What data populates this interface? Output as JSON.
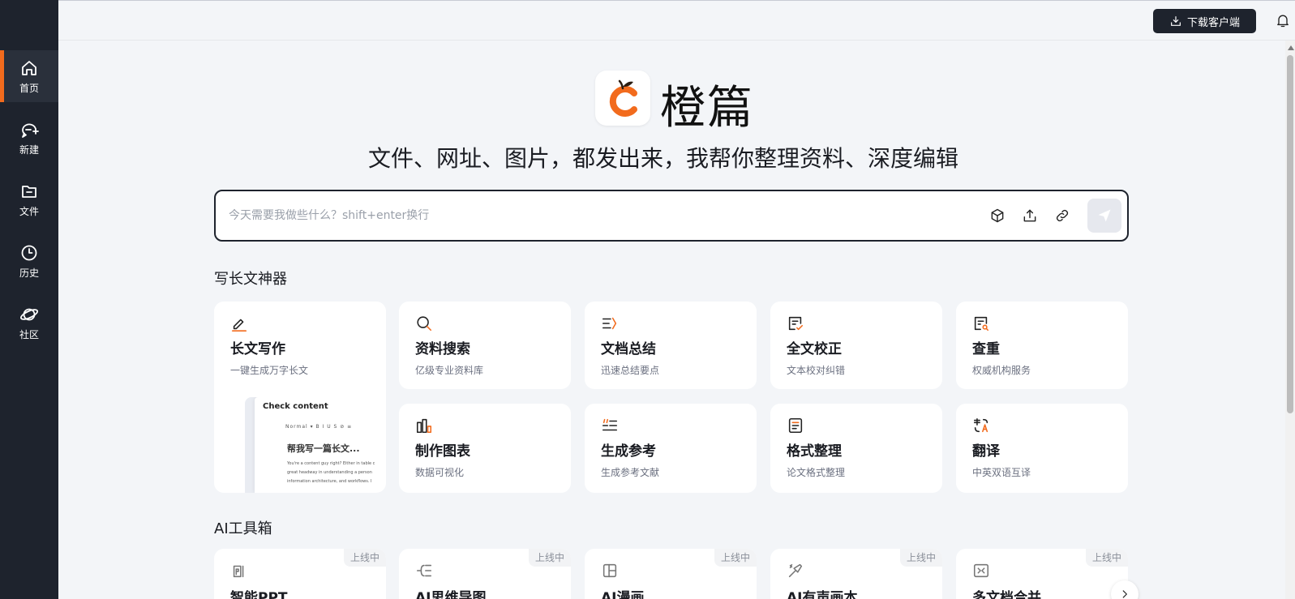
{
  "sidebar": {
    "items": [
      {
        "label": "首页",
        "icon": "home-icon",
        "active": true
      },
      {
        "label": "新建",
        "icon": "new-chat-icon",
        "active": false
      },
      {
        "label": "文件",
        "icon": "folder-icon",
        "active": false
      },
      {
        "label": "历史",
        "icon": "clock-icon",
        "active": false
      },
      {
        "label": "社区",
        "icon": "planet-icon",
        "active": false
      }
    ]
  },
  "header": {
    "download_label": "下载客户端"
  },
  "hero": {
    "brand": "橙篇",
    "tagline": "文件、网址、图片，都发出来，我帮你整理资料、深度编辑"
  },
  "search": {
    "placeholder": "今天需要我做些什么？shift+enter换行"
  },
  "writing_section": {
    "title": "写长文神器",
    "featured": {
      "title": "长文写作",
      "desc": "一键生成万字长文",
      "icon": "pen-icon",
      "preview": {
        "title": "Check content",
        "toolbar": "Normal ▾   B  I  U  S  ⊘   ≡",
        "heading": "帮我写一篇长文...",
        "lines": [
          "You're a content guy right? Either in table c",
          "great headway in understanding a person",
          "information architecture, and workflows. I"
        ]
      }
    },
    "cards": [
      {
        "title": "资料搜索",
        "desc": "亿级专业资料库",
        "icon": "search-icon"
      },
      {
        "title": "文档总结",
        "desc": "迅速总结要点",
        "icon": "summary-icon"
      },
      {
        "title": "全文校正",
        "desc": "文本校对纠错",
        "icon": "proofread-icon"
      },
      {
        "title": "查重",
        "desc": "权威机构服务",
        "icon": "plagiarism-check-icon"
      },
      {
        "title": "制作图表",
        "desc": "数据可视化",
        "icon": "chart-icon"
      },
      {
        "title": "生成参考",
        "desc": "生成参考文献",
        "icon": "reference-icon"
      },
      {
        "title": "格式整理",
        "desc": "论文格式整理",
        "icon": "format-icon"
      },
      {
        "title": "翻译",
        "desc": "中英双语互译",
        "icon": "translate-icon"
      }
    ]
  },
  "tools_section": {
    "title": "AI工具箱",
    "badge": "上线中",
    "cards": [
      {
        "title": "智能PPT",
        "icon": "ppt-icon"
      },
      {
        "title": "AI思维导图",
        "icon": "mindmap-icon"
      },
      {
        "title": "AI漫画",
        "icon": "comic-icon"
      },
      {
        "title": "AI有声画本",
        "icon": "audiobook-icon"
      },
      {
        "title": "多文档合并",
        "icon": "merge-icon"
      }
    ]
  },
  "colors": {
    "accent": "#f26b1d",
    "sidebar_bg": "#1e232d",
    "page_bg": "#f3f5f8"
  }
}
